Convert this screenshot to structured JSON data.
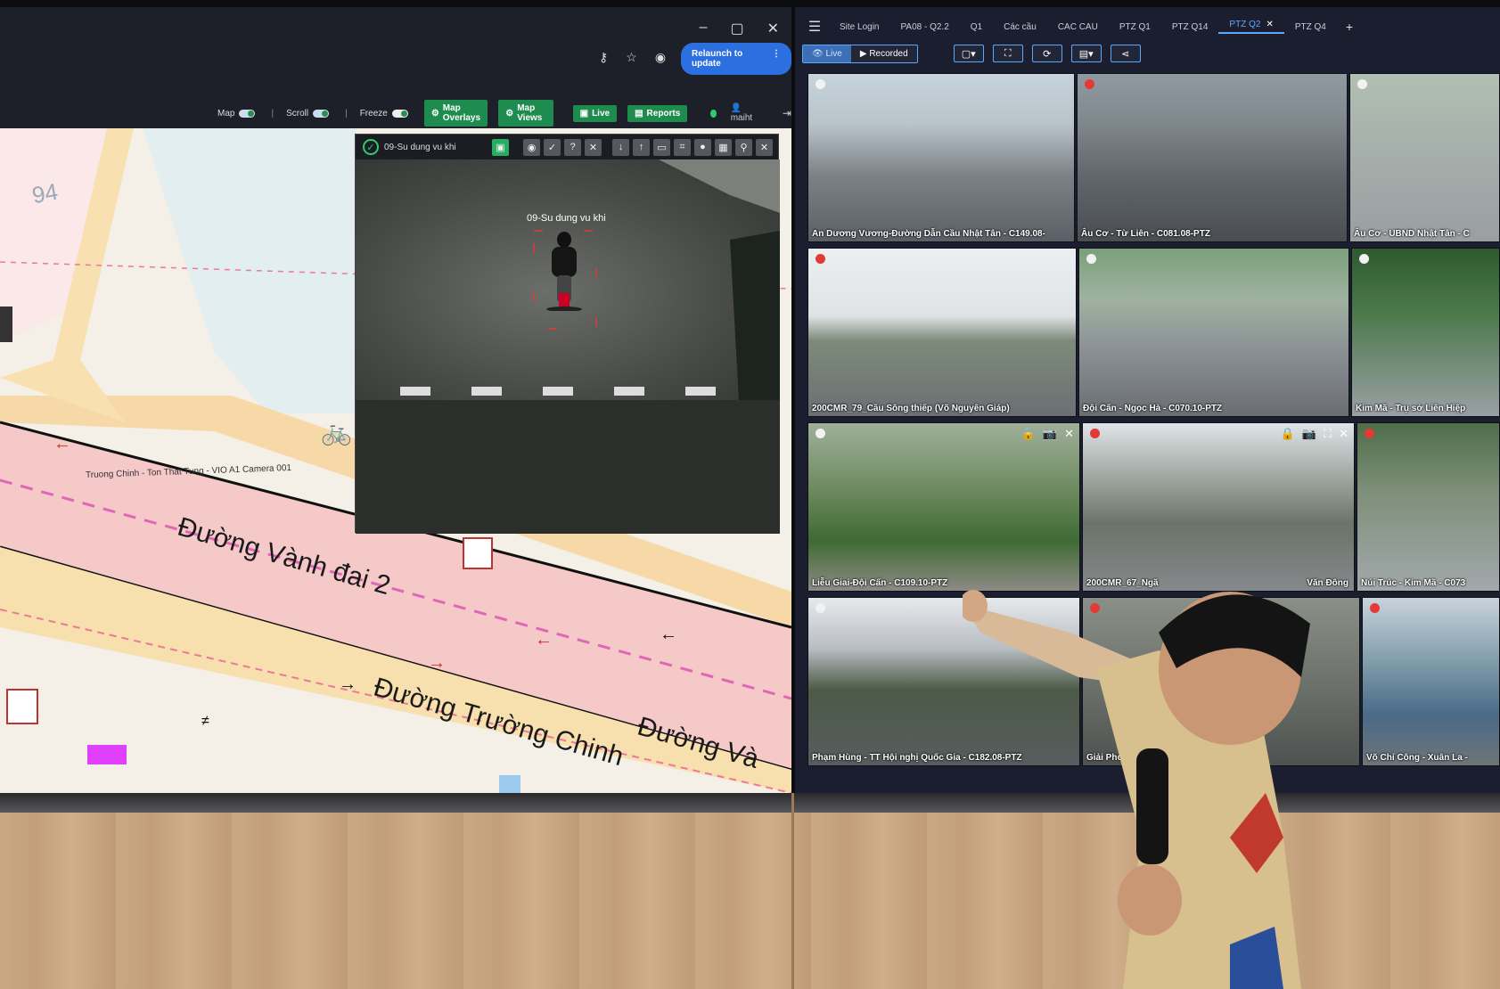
{
  "left_window": {
    "controls": [
      "–",
      "▢",
      "✕"
    ],
    "relaunch_label": "Relaunch to update",
    "toolbar": {
      "map_label": "Map",
      "scroll_label": "Scroll",
      "freeze_label": "Freeze",
      "map_overlays_label": "Map Overlays",
      "map_views_label": "Map Views",
      "live_label": "Live",
      "reports_label": "Reports",
      "user_label": "maiht"
    },
    "map": {
      "area_number": "94",
      "camera_label": "Truong Chinh - Ton That Tung - VIO A1 Camera 001",
      "roads": [
        "Đường Vành đai 2",
        "Đường Trường Chinh",
        "Đường Và"
      ]
    },
    "popup": {
      "title": "09-Su dung vu khi",
      "video_label": "09-Su dung vu khi"
    }
  },
  "right_window": {
    "tabs": [
      "Site Login",
      "PA08 - Q2.2",
      "Q1",
      "Các cầu",
      "CAC CAU",
      "PTZ Q1",
      "PTZ Q14",
      "PTZ Q2",
      "PTZ Q4"
    ],
    "active_tab": "PTZ Q2",
    "live_label": "Live",
    "recorded_label": "Recorded",
    "cameras": [
      {
        "label": "An Dương Vương-Đường Dẫn Cầu Nhật Tân - C149.08-",
        "dot": "white"
      },
      {
        "label": "Âu Cơ - Từ Liên - C081.08-PTZ",
        "dot": "red"
      },
      {
        "label": "Âu Cơ - UBND Nhật Tân - C",
        "dot": "white"
      },
      {
        "label": "200CMR_79_Cầu Sông thiếp (Võ Nguyên Giáp)",
        "dot": "red"
      },
      {
        "label": "Đội Cấn - Ngọc Hà - C070.10-PTZ",
        "dot": "white"
      },
      {
        "label": "Kim Mã - Trụ sở Liên Hiệp",
        "dot": "white"
      },
      {
        "label": "Liễu Giai-Đội Cấn - C109.10-PTZ",
        "dot": "white"
      },
      {
        "label": "200CMR_67_Ngã",
        "dot": "red"
      },
      {
        "label": "Núi Trúc - Kim Mã - C073",
        "dot": "red"
      },
      {
        "label": "Phạm Hùng - TT Hội nghị Quốc Gia - C182.08-PTZ",
        "dot": "white"
      },
      {
        "label": "Giải Phó",
        "dot": "red"
      },
      {
        "label": "Võ Chí Công - Xuân La -",
        "dot": "red"
      }
    ],
    "row3_overlay": "Văn Đông"
  },
  "colors": {
    "accent_blue": "#2b6fe0",
    "tab_active": "#5aa9ff",
    "green_button": "#1e8c4e",
    "rec_red": "#e53935"
  }
}
